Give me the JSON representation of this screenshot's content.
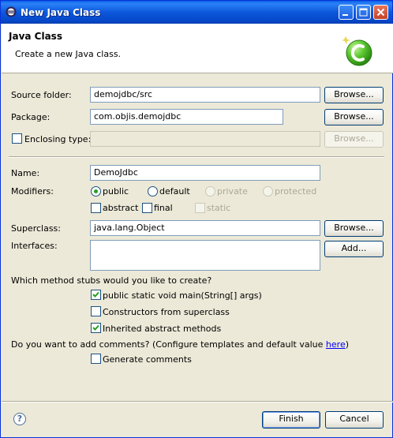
{
  "window": {
    "title": "New Java Class"
  },
  "header": {
    "title": "Java Class",
    "description": "Create a new Java class."
  },
  "form": {
    "source_folder": {
      "label": "Source folder:",
      "value": "demojdbc/src",
      "button": "Browse..."
    },
    "package": {
      "label": "Package:",
      "value": "com.objis.demojdbc",
      "button": "Browse..."
    },
    "enclosing_type": {
      "label": "Enclosing type:",
      "value": "",
      "button": "Browse...",
      "checked": false
    },
    "name": {
      "label": "Name:",
      "value": "DemoJdbc"
    },
    "modifiers": {
      "label": "Modifiers:",
      "public": "public",
      "default": "default",
      "private": "private",
      "protected": "protected",
      "selected": "public",
      "abstract": "abstract",
      "final": "final",
      "static": "static"
    },
    "superclass": {
      "label": "Superclass:",
      "value": "java.lang.Object",
      "button": "Browse..."
    },
    "interfaces": {
      "label": "Interfaces:",
      "button": "Add..."
    },
    "stubs": {
      "question": "Which method stubs would you like to create?",
      "main": {
        "label": "public static void main(String[] args)",
        "checked": true
      },
      "constructors": {
        "label": "Constructors from superclass",
        "checked": false
      },
      "inherited": {
        "label": "Inherited abstract methods",
        "checked": true
      }
    },
    "comments": {
      "question": "Do you want to add comments? (Configure templates and default value ",
      "link": "here",
      "question_end": ")",
      "generate": {
        "label": "Generate comments",
        "checked": false
      }
    }
  },
  "footer": {
    "help": "?",
    "finish": "Finish",
    "cancel": "Cancel"
  },
  "colors": {
    "title_bar": "#0a5fe8",
    "dialog_bg": "#ece9d8",
    "check_mark": "#21a121",
    "link": "#0000ff"
  }
}
